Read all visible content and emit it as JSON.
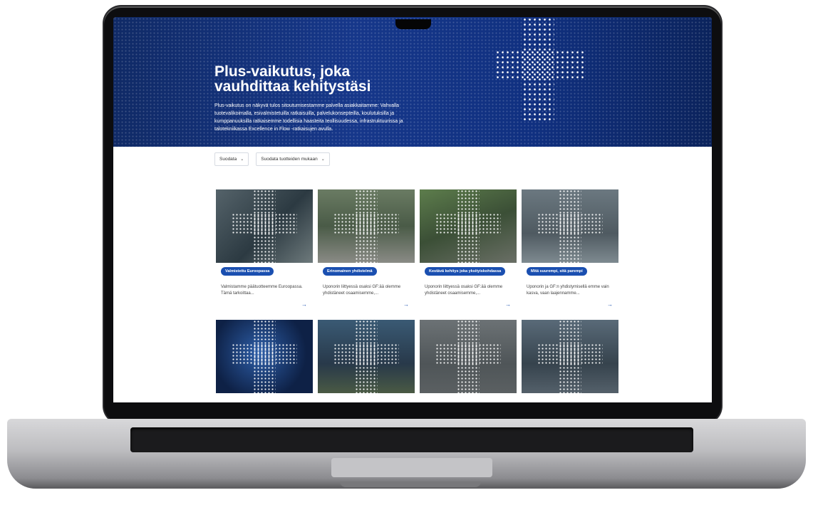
{
  "hero": {
    "title": "Plus-vaikutus, joka vauhdittaa kehitystäsi",
    "description": "Plus-vaikutus on näkyvä tulos sitoutumisestamme palvella asiakkaitamme: Vahvalla tuotevalikoimalla, esivalmistetuilla ratkaisuilla, palvelukonsepteilla, koulutuksilla ja kumppanuuksilla ratkaisemme todellisia haasteita teollisuudessa, infrastruktuurissa ja talotekniikassa Excellence in Flow -ratkaisujen avulla."
  },
  "filters": [
    {
      "label": "Suodata"
    },
    {
      "label": "Suodata tuotteiden mukaan"
    }
  ],
  "cards": [
    {
      "tag": "Valmistettu Euroopassa",
      "text": "Valmistamme päätuotteemme Euroopassa. Tämä tarkoittaa..."
    },
    {
      "tag": "Erinomainen yhdistelmä",
      "text": "Uponorin liittyessä osaksi GF:ää olemme yhdistäneet osaamisemme,..."
    },
    {
      "tag": "Kestävä kehitys joka yksityiskohdassa",
      "text": "Uponorin liittyessä osaksi GF:ää olemme yhdistäneet osaamisemme,..."
    },
    {
      "tag": "Mitä suurempi, sitä parempi",
      "text": "Uponorin ja GF:n yhdistymisellä emme vain kasva, vaan laajennamme..."
    },
    {
      "tag": "",
      "text": ""
    },
    {
      "tag": "",
      "text": ""
    },
    {
      "tag": "",
      "text": ""
    },
    {
      "tag": "",
      "text": ""
    }
  ],
  "icons": {
    "arrow": "→",
    "chevron": "⌄"
  },
  "colors": {
    "hero_blue": "#16378a",
    "accent_blue": "#1a4fb0"
  }
}
